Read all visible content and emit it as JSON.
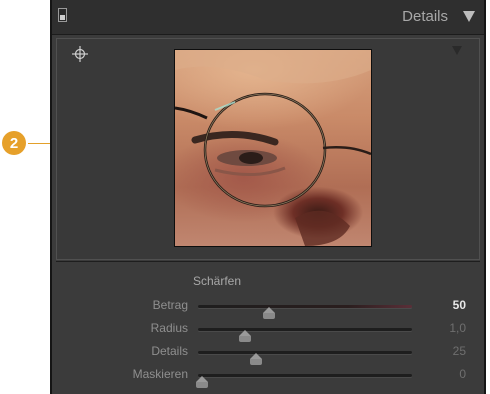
{
  "callout": {
    "number": "2",
    "color": "#e6a02a"
  },
  "header": {
    "title": "Details"
  },
  "sharpening": {
    "title": "Schärfen",
    "sliders": [
      {
        "label": "Betrag",
        "value": "50",
        "level": 0.33,
        "active": true
      },
      {
        "label": "Radius",
        "value": "1,0",
        "level": 0.22,
        "active": false
      },
      {
        "label": "Details",
        "value": "25",
        "level": 0.27,
        "active": false
      },
      {
        "label": "Maskieren",
        "value": "0",
        "level": 0.02,
        "active": false
      }
    ]
  },
  "colors": {
    "panel": "#3b3b3b",
    "header": "#2f2f2f",
    "accent": "#e6a02a"
  }
}
